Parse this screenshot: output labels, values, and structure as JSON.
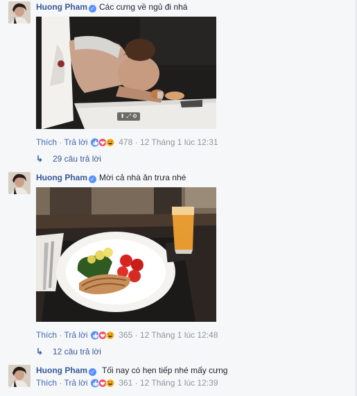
{
  "comments": [
    {
      "author": "Huong Pham",
      "text": "Các cưng về ngủ đi nhá",
      "like_label": "Thích",
      "reply_label": "Trả lời",
      "reaction_count": "478",
      "timestamp": "12 Tháng 1 lúc 12:31",
      "replies_label": "29 câu trả lời",
      "photo_icon": "sleeping-woman-photo"
    },
    {
      "author": "Huong Pham",
      "text": "Mời cả nhà ăn trưa nhé",
      "like_label": "Thích",
      "reply_label": "Trả lời",
      "reaction_count": "365",
      "timestamp": "12 Tháng 1 lúc 12:48",
      "replies_label": "12 câu trả lời",
      "photo_icon": "lunch-plate-photo"
    },
    {
      "author": "Huong Pham",
      "text": "Tối nay có hẹn tiếp nhé mấy cưng",
      "like_label": "Thích",
      "reply_label": "Trả lời",
      "reaction_count": "361",
      "timestamp": "12 Tháng 1 lúc 12:39"
    }
  ],
  "separator": " · ",
  "colors": {
    "link": "#4267b2",
    "author": "#365899",
    "meta": "#90949c",
    "like": "#5890ff",
    "love": "#f25268",
    "haha": "#f7b125"
  }
}
